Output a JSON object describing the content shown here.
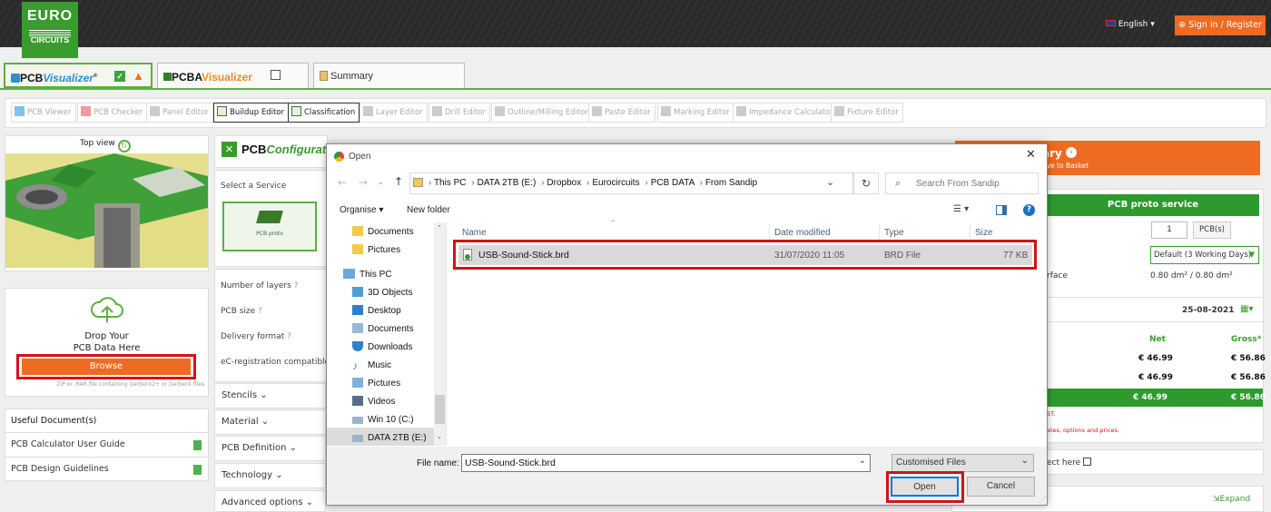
{
  "header": {
    "logo_top": "EURO",
    "logo_bottom": "CIRCUITS",
    "language": "English",
    "sign_in": "Sign in / Register"
  },
  "tabs": [
    {
      "label_a": "PCB",
      "label_b": "Visualizer",
      "sup": "®"
    },
    {
      "label_a": "PCBA",
      "label_b": "Visualizer"
    },
    {
      "label": "Summary"
    }
  ],
  "toolbar": [
    "PCB Viewer",
    "PCB Checker",
    "Panel Editor",
    "Buildup Editor",
    "Classification",
    "Layer Editor",
    "Drill Editor",
    "Outline/Milling Editor",
    "Paste Editor",
    "Marking Editor",
    "Impedance Calculator",
    "Fixture Editor"
  ],
  "left": {
    "top_view": "Top view",
    "drop_title_1": "Drop Your",
    "drop_title_2": "PCB Data Here",
    "browse": "Browse",
    "hint": "ZIP or .RAR file containing GerberX2+ or GerberX files.",
    "useful_docs": "Useful Document(s)",
    "docs": [
      "PCB Calculator User Guide",
      "PCB Design Guidelines"
    ]
  },
  "configurator": {
    "title_a": "PCB",
    "title_b": "Configurator",
    "select_service": "Select a Service",
    "service_label": "PCB proto",
    "rows": [
      "Number of layers",
      "PCB size",
      "Delivery format",
      "eC-registration compatible PC"
    ],
    "sections": [
      "Stencils",
      "Material",
      "PCB Definition",
      "Technology",
      "Advanced options"
    ]
  },
  "right": {
    "banner_text": "ary",
    "banner_sub": "ave to Basket",
    "service_title": "PCB proto service",
    "qty": "1",
    "qty_unit": "PCB(s)",
    "delivery": "Default (3 Working Days)",
    "surface_label": "rface",
    "surface_value": "0.80 dm² / 0.80 dm²",
    "date": "25-08-2021",
    "net_label": "Net",
    "gross_label": "Gross*",
    "rows": [
      {
        "net": "€ 46.99",
        "gross": "€ 56.86"
      },
      {
        "net": "€ 46.99",
        "gross": "€ 56.86"
      },
      {
        "net": "€ 46.99",
        "gross": "€ 56.86"
      }
    ],
    "note1": "ST.",
    "note2": "ates, options and prices.",
    "select_here": "ect here",
    "expand": "Expand"
  },
  "dialog": {
    "title": "Open",
    "path": [
      "This PC",
      "DATA 2TB (E:)",
      "Dropbox",
      "Eurocircuits",
      "PCB DATA",
      "From Sandip"
    ],
    "search_placeholder": "Search From Sandip",
    "organise": "Organise",
    "new_folder": "New folder",
    "nav": [
      {
        "label": "Documents",
        "icon": "folder-icon"
      },
      {
        "label": "Pictures",
        "icon": "folder-icon"
      },
      {
        "label": "This PC",
        "icon": "computer-icon"
      },
      {
        "label": "3D Objects",
        "icon": "cube-icon"
      },
      {
        "label": "Desktop",
        "icon": "desktop-icon"
      },
      {
        "label": "Documents",
        "icon": "documents-icon"
      },
      {
        "label": "Downloads",
        "icon": "download-icon"
      },
      {
        "label": "Music",
        "icon": "music-icon"
      },
      {
        "label": "Pictures",
        "icon": "pictures-icon"
      },
      {
        "label": "Videos",
        "icon": "video-icon"
      },
      {
        "label": "Win 10 (C:)",
        "icon": "drive-icon"
      },
      {
        "label": "DATA 2TB (E:)",
        "icon": "drive-icon"
      }
    ],
    "columns": [
      "Name",
      "Date modified",
      "Type",
      "Size"
    ],
    "files": [
      {
        "name": "USB-Sound-Stick.brd",
        "modified": "31/07/2020 11:05",
        "type": "BRD File",
        "size": "77 KB"
      }
    ],
    "file_name_label": "File name:",
    "file_name_value": "USB-Sound-Stick.brd",
    "filter": "Customised Files",
    "open": "Open",
    "cancel": "Cancel"
  },
  "colors": {
    "accent_green": "#3a9b2e",
    "orange": "#ee6b21",
    "highlight_red": "#d0131b"
  }
}
